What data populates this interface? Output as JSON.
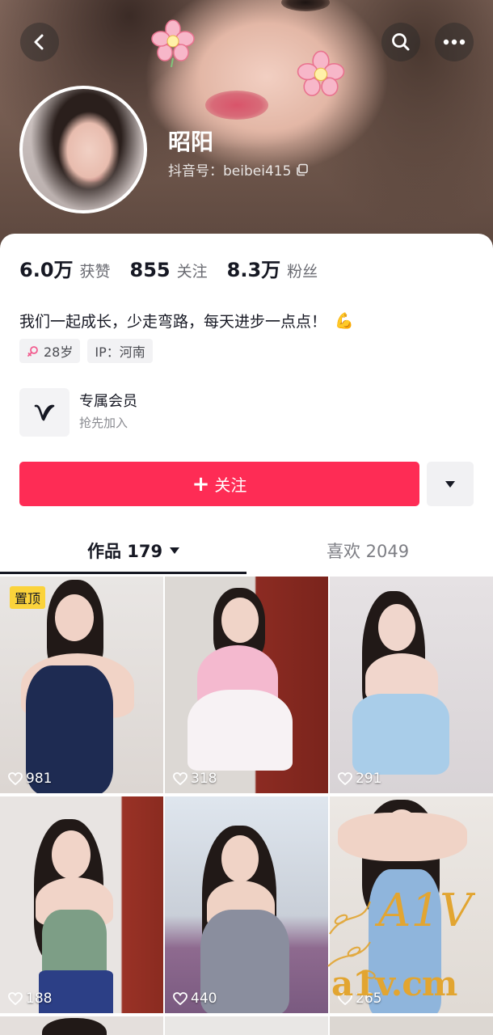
{
  "profile": {
    "nickname": "昭阳",
    "douyin_id": "抖音号：beibei415",
    "stats": [
      {
        "value": "6.0万",
        "label": "获赞"
      },
      {
        "value": "855",
        "label": "关注"
      },
      {
        "value": "8.3万",
        "label": "粉丝"
      }
    ],
    "bio": "我们一起成长，少走弯路，每天进步一点点！",
    "bio_emoji": "💪",
    "tags": {
      "age": "28岁",
      "ip": "IP：河南"
    }
  },
  "membership": {
    "title": "专属会员",
    "subtitle": "抢先加入"
  },
  "actions": {
    "follow_label": "关注",
    "follow_plus": "+"
  },
  "tabs": [
    {
      "label": "作品 179",
      "active": true
    },
    {
      "label": "喜欢 2049",
      "active": false
    }
  ],
  "videos": [
    {
      "likes": "981",
      "pinned_label": "置顶"
    },
    {
      "likes": "318"
    },
    {
      "likes": "291"
    },
    {
      "likes": "188"
    },
    {
      "likes": "440"
    },
    {
      "likes": "265"
    }
  ],
  "watermark": {
    "text": "a1v.cm",
    "logo": "A1V"
  },
  "colors": {
    "accent": "#fe2c55",
    "pin": "#fbd33b"
  }
}
